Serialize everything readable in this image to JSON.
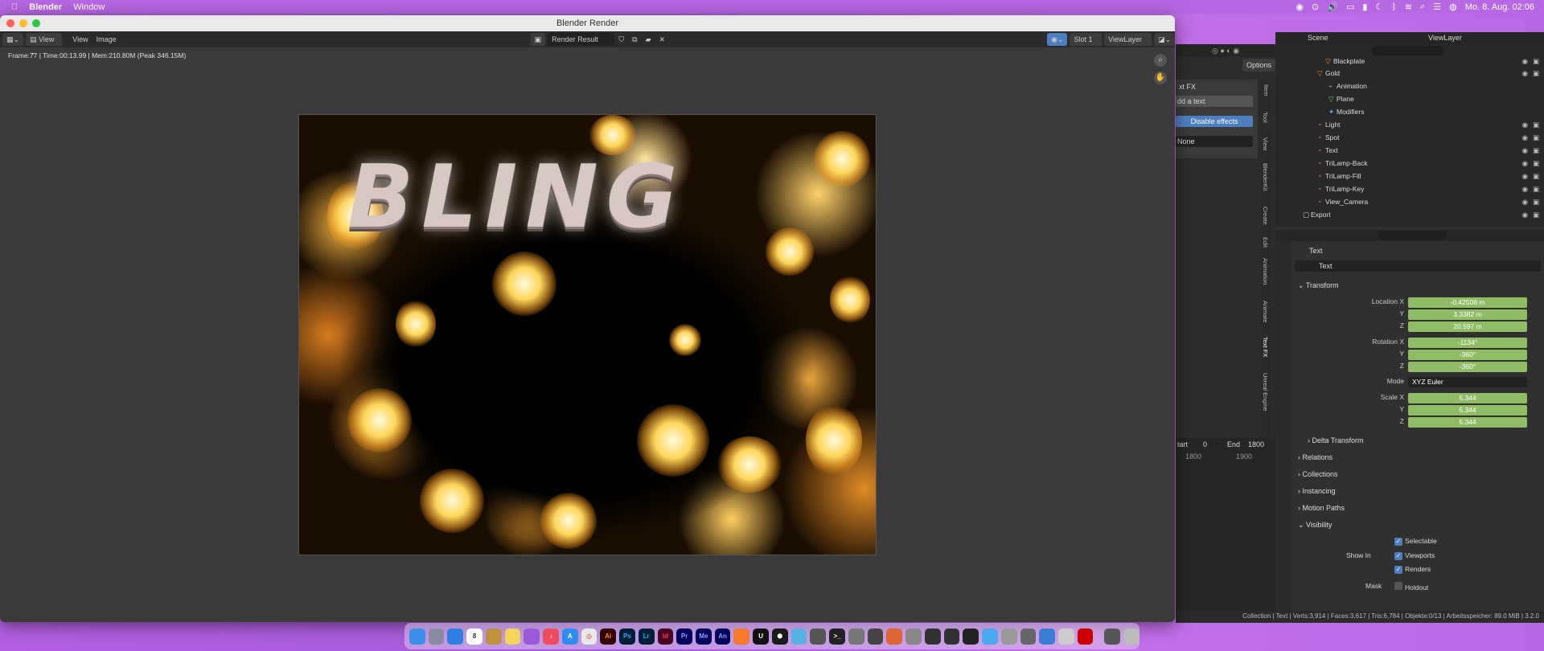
{
  "menubar": {
    "app": "Blender",
    "menu_window": "Window",
    "datetime": "Mo. 8. Aug.  02:06"
  },
  "window": {
    "title": "Blender Render",
    "toolbar": {
      "view1": "View",
      "view2": "View",
      "image": "Image",
      "render_result": "Render Result",
      "slot": "Slot 1",
      "viewlayer": "ViewLayer"
    },
    "frame_info": "Frame:77 | Time:00:13.99 | Mem:210.80M (Peak 346.15M)",
    "render_text": "BLING"
  },
  "sidepanel": {
    "options": "Options",
    "textfx_label": "xt FX",
    "add_text": "dd a text",
    "disable_effects": "Disable effects",
    "none": "None",
    "tabs": [
      "Item",
      "Tool",
      "View",
      "BlenderKit",
      "Create",
      "Edit",
      "Animation",
      "Animate",
      "Text FX",
      "Unreal Engine"
    ],
    "timeline_start_label": "tart",
    "timeline_start": "0",
    "timeline_end_label": "End",
    "timeline_end": "1800",
    "ruler1": "1800",
    "ruler2": "1900"
  },
  "outliner": {
    "scene": "Scene",
    "viewlayer": "ViewLayer",
    "items": [
      "Blackplate",
      "Gold",
      "Animation",
      "Plane",
      "Modifiers",
      "Light",
      "Spot",
      "Text",
      "TriLamp-Back",
      "TriLamp-Fill",
      "TriLamp-Key",
      "View_Camera",
      "Export"
    ]
  },
  "properties": {
    "object_name": "Text",
    "data_name": "Text",
    "transform": "Transform",
    "location_x_label": "Location X",
    "location_x": "-0.42506 m",
    "location_y": "3.3382 m",
    "location_z": "20.597 m",
    "rotation_x_label": "Rotation X",
    "rotation_x": "-1134°",
    "rotation_y": "-360°",
    "rotation_z": "-360°",
    "y_label": "Y",
    "z_label": "Z",
    "mode_label": "Mode",
    "mode": "XYZ Euler",
    "scale_x_label": "Scale X",
    "scale_x": "5.344",
    "scale_y": "5.344",
    "scale_z": "5.344",
    "delta_transform": "Delta Transform",
    "relations": "Relations",
    "collections": "Collections",
    "instancing": "Instancing",
    "motion_paths": "Motion Paths",
    "visibility": "Visibility",
    "selectable": "Selectable",
    "show_in": "Show In",
    "viewports": "Viewports",
    "renders": "Renders",
    "mask": "Mask",
    "holdout": "Holdout"
  },
  "statusbar": "Collection | Text | Verts:3,914 | Faces:3,617 | Tris:6,784 | Objekte:0/13 | Arbeitsspeicher: 89.0 MiB | 3.2.0",
  "dock": [
    "Finder",
    "Launchpad",
    "Safari",
    "Calendar",
    "Notes",
    "Podcasts",
    "Music",
    "App Store",
    "Chrome",
    "Ai",
    "Ps",
    "Lr",
    "Id",
    "Pr",
    "Me",
    "An",
    "Blender",
    "Unreal",
    "Terminal",
    "Preview",
    "Trash"
  ],
  "colors": {
    "desktop": "#b25fe0",
    "accent_blue": "#4d7fc0",
    "field_green": "#8fbd66"
  }
}
